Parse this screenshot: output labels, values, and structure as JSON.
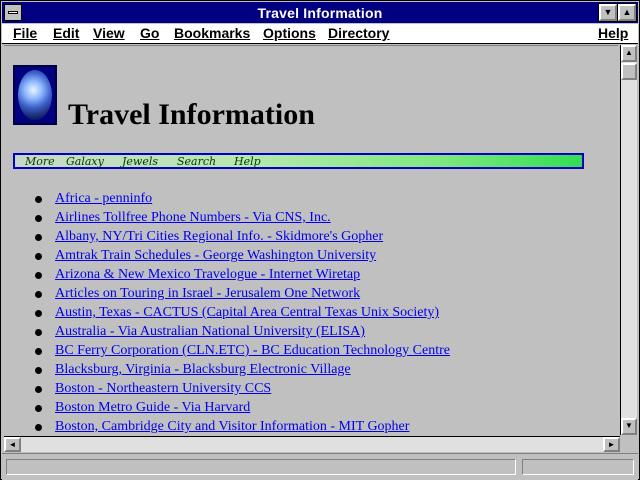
{
  "window": {
    "title": "Travel Information",
    "minimize_glyph": "▼",
    "maximize_glyph": "▲"
  },
  "menu": {
    "items": [
      {
        "label": "File"
      },
      {
        "label": "Edit"
      },
      {
        "label": "View"
      },
      {
        "label": "Go"
      },
      {
        "label": "Bookmarks"
      },
      {
        "label": "Options"
      },
      {
        "label": "Directory"
      },
      {
        "label": "Help"
      }
    ]
  },
  "page": {
    "logo_icon": "galaxy-jewel-icon",
    "heading": "Travel Information",
    "nav": [
      "More",
      "Galaxy",
      "Jewels",
      "Search",
      "Help"
    ],
    "links": [
      "Africa - penninfo",
      "Airlines Tollfree Phone Numbers - Via CNS, Inc.",
      "Albany, NY/Tri Cities Regional Info. - Skidmore's Gopher",
      "Amtrak Train Schedules - George Washington University",
      "Arizona & New Mexico Travelogue - Internet Wiretap",
      "Articles on Touring in Israel - Jerusalem One Network",
      "Austin, Texas - CACTUS (Capital Area Central Texas Unix Society)",
      "Australia - Via Australian National University (ELISA)",
      "BC Ferry Corporation (CLN.ETC) - BC Education Technology Centre",
      "Blacksburg, Virginia - Blacksburg Electronic Village",
      "Boston - Northeastern University CCS",
      "Boston Metro Guide - Via Harvard",
      "Boston, Cambridge City and Visitor Information - MIT Gopher"
    ]
  },
  "scrollbars": {
    "up_glyph": "▲",
    "down_glyph": "▼",
    "left_glyph": "◄",
    "right_glyph": "►"
  },
  "colors": {
    "titlebar": "#000080",
    "link": "#0000ee",
    "background": "#c0c0c0"
  }
}
